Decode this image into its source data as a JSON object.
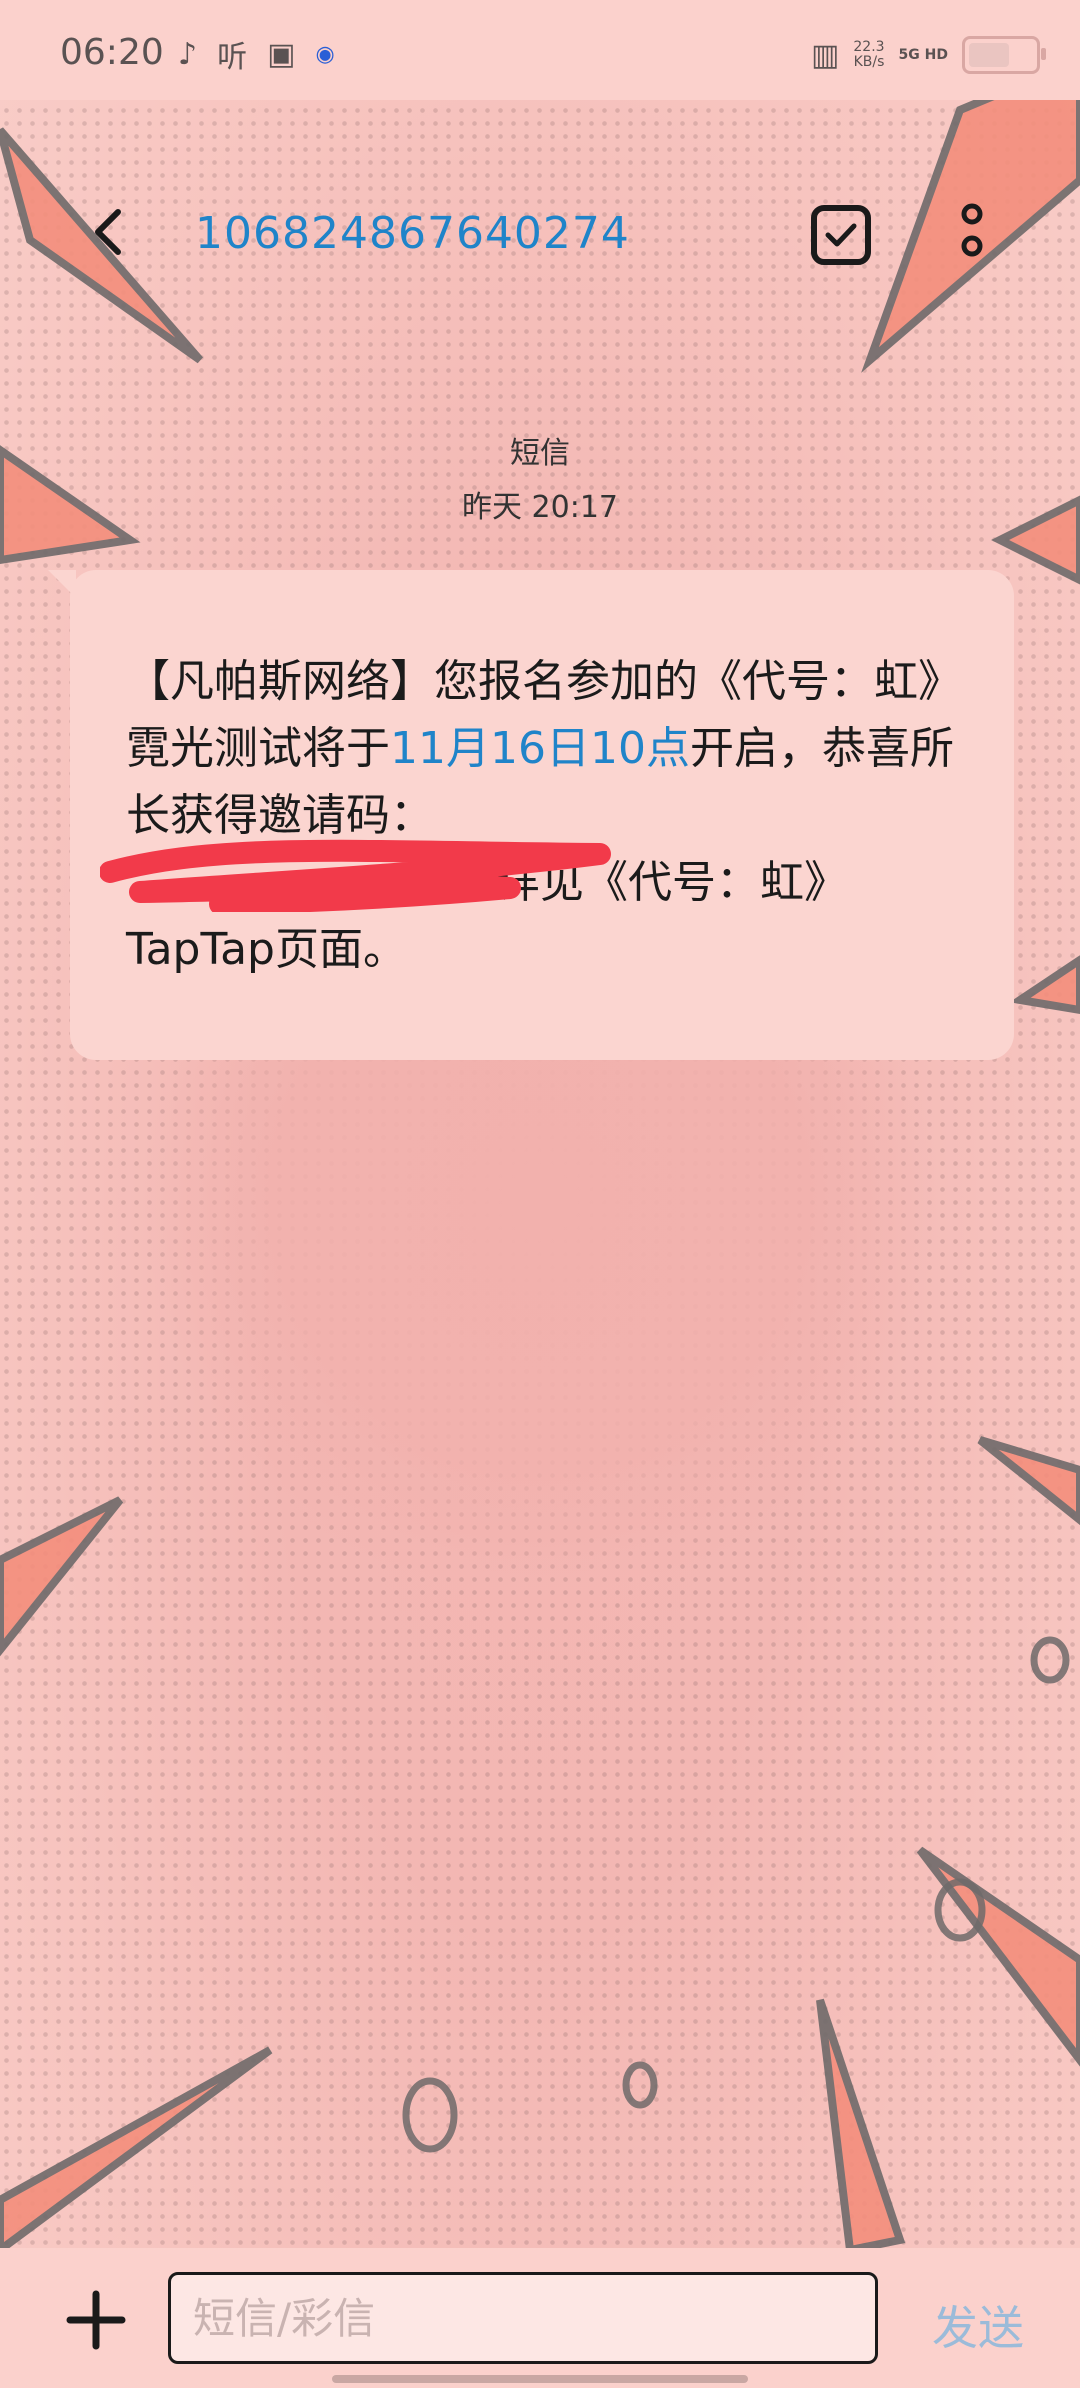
{
  "status_bar": {
    "time": "06:20",
    "icons": [
      "tiktok-icon",
      "ting-icon",
      "clipboard-icon",
      "browser-icon"
    ],
    "ting_label": "听",
    "net_speed_value": "22.3",
    "net_speed_unit": "KB/s",
    "network": "5G HD",
    "battery_level": 0.62
  },
  "header": {
    "title": "106824867640274"
  },
  "conversation": {
    "message_type": "短信",
    "timestamp": "昨天 20:17"
  },
  "message": {
    "part1": "【凡帕斯网络】您报名参加的《代号：虹》霓光测试将于",
    "highlight": "11月16日10点",
    "part2": "开启，恭喜所长获得邀请码：",
    "part3": "详见《代号：虹》TapTap页面。"
  },
  "composer": {
    "placeholder": "短信/彩信",
    "send_label": "发送"
  },
  "colors": {
    "accent": "#1f84c9",
    "bubble": "#fbd5d0",
    "background": "#f0b8b4"
  }
}
